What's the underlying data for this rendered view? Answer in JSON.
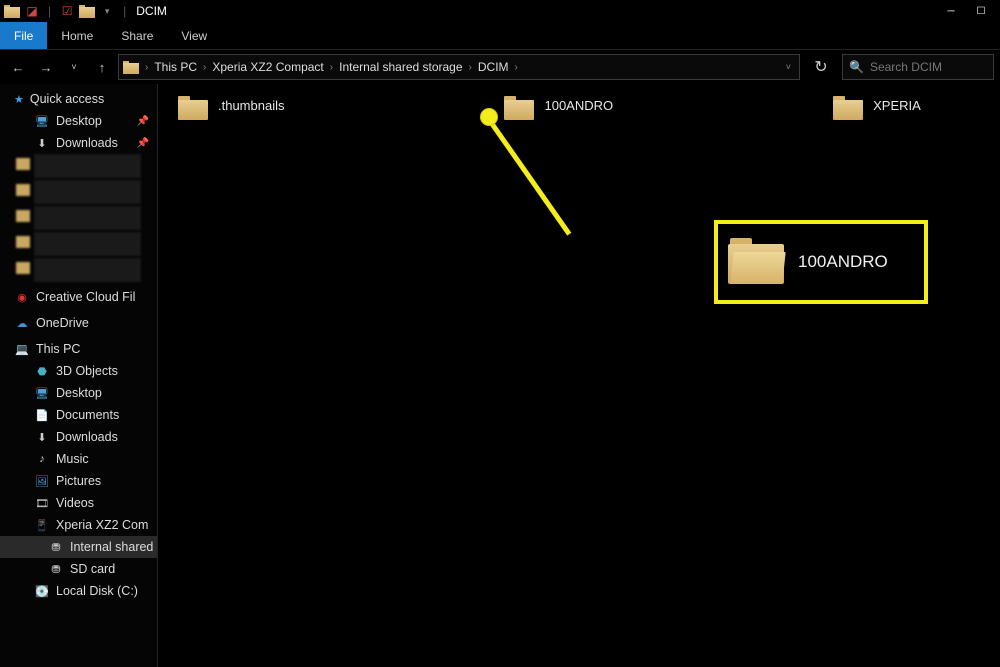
{
  "window": {
    "title": "DCIM"
  },
  "ribbon": {
    "file": "File",
    "home": "Home",
    "share": "Share",
    "view": "View"
  },
  "nav": {
    "breadcrumbs": [
      "This PC",
      "Xperia XZ2 Compact",
      "Internal shared storage",
      "DCIM"
    ],
    "search_placeholder": "Search DCIM"
  },
  "sidebar": {
    "quick_access": "Quick access",
    "desktop": "Desktop",
    "downloads": "Downloads",
    "creative_cloud": "Creative Cloud Fil",
    "onedrive": "OneDrive",
    "this_pc": "This PC",
    "objects3d": "3D Objects",
    "pc_desktop": "Desktop",
    "documents": "Documents",
    "pc_downloads": "Downloads",
    "music": "Music",
    "pictures": "Pictures",
    "videos": "Videos",
    "xperia": "Xperia XZ2 Com",
    "internal": "Internal shared",
    "sdcard": "SD card",
    "localdisk": "Local Disk (C:)"
  },
  "folders": {
    "items": [
      {
        "name": ".thumbnails"
      },
      {
        "name": "100ANDRO"
      },
      {
        "name": "XPERIA"
      }
    ]
  },
  "callout": {
    "label": "100ANDRO"
  },
  "colors": {
    "accent": "#1979ca",
    "highlight": "#f4ec1b"
  }
}
